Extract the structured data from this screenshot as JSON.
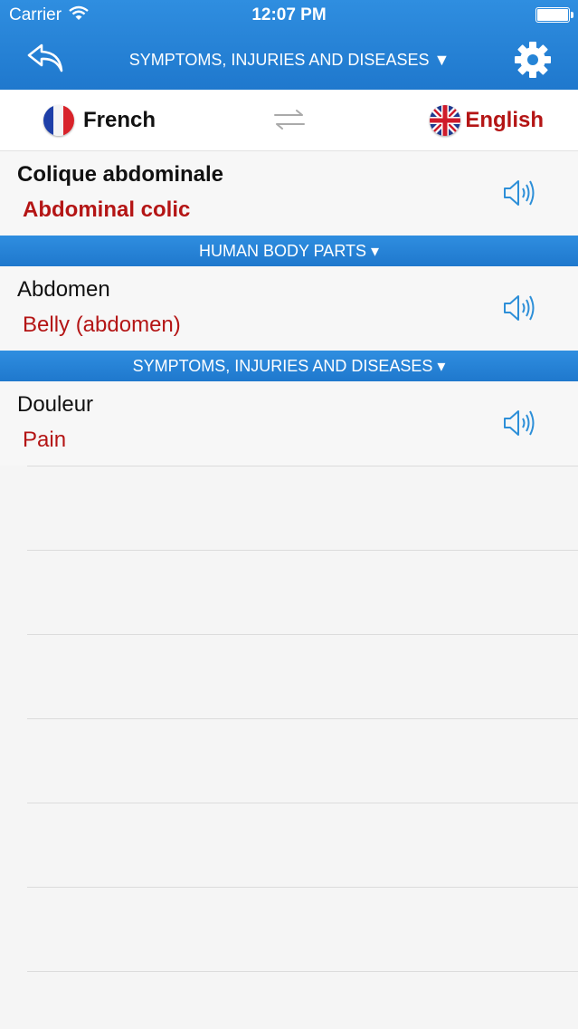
{
  "status_bar": {
    "carrier": "Carrier",
    "time": "12:07 PM"
  },
  "nav": {
    "title": "SYMPTOMS, INJURIES AND DISEASES ▼",
    "back_icon": "undo-arrow-icon",
    "settings_icon": "gear-icon"
  },
  "languages": {
    "source": "French",
    "target": "English",
    "swap_icon": "swap-arrows-icon"
  },
  "entries": [
    {
      "source": "Colique abdominale",
      "translation": "Abdominal colic"
    },
    {
      "source": "Abdomen",
      "translation": "Belly (abdomen)"
    },
    {
      "source": "Douleur",
      "translation": "Pain"
    }
  ],
  "sections": [
    {
      "label": "HUMAN BODY PARTS ▾"
    },
    {
      "label": "SYMPTOMS, INJURIES AND DISEASES ▾"
    }
  ],
  "colors": {
    "header_blue": "#1f78cd",
    "translation_red": "#b41515"
  }
}
